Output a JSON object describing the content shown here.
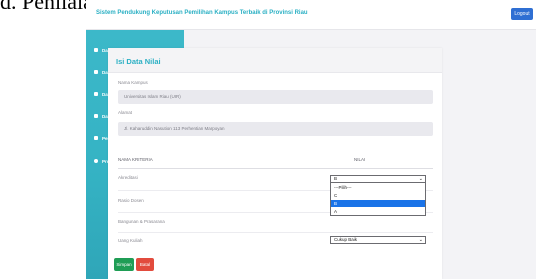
{
  "caption": "d. Penilaian",
  "header": {
    "title": "Sistem Pendukung Keputusan Pemilihan Kampus Terbaik di Provinsi Riau",
    "logout_label": "Logout"
  },
  "sidebar": {
    "items": [
      {
        "label": "Dashboard",
        "icon": "home-icon"
      },
      {
        "label": "Data Kampus",
        "icon": "building-icon"
      },
      {
        "label": "Data Kriteria",
        "icon": "pencil-icon"
      },
      {
        "label": "Data Fuzzy",
        "icon": "pencil-icon"
      },
      {
        "label": "Penilaian",
        "icon": "pencil-icon"
      },
      {
        "label": "Proses Moora",
        "icon": "gear-icon"
      }
    ]
  },
  "form": {
    "title": "Isi Data Nilai",
    "nama_kampus_label": "Nama Kampus",
    "nama_kampus_value": "Universitas Islam Riau (UIR)",
    "alamat_label": "Alamat",
    "alamat_value": "Jl. Kaharuddin Nasution 113 Perhentian Marpoyan",
    "col_kriteria": "NAMA KRITERIA",
    "col_nilai": "NILAI",
    "criteria": [
      {
        "name": "Akreditasi",
        "value": "B"
      },
      {
        "name": "Rasio Dosen",
        "value": ""
      },
      {
        "name": "Bangunan & Prasarana",
        "value": ""
      },
      {
        "name": "Uang Kuliah",
        "value": "Cukup Baik"
      }
    ],
    "dropdown_options": [
      "---Pilih---",
      "C",
      "B",
      "A"
    ],
    "dropdown_selected": "B",
    "save_label": "Simpan",
    "cancel_label": "Batal"
  },
  "colors": {
    "accent": "#2bb0c4",
    "sidebar": "#35b3c4",
    "logout": "#2f6fd3",
    "save": "#1f9d55",
    "cancel": "#e24b3d",
    "option_highlight": "#1a73e8"
  }
}
